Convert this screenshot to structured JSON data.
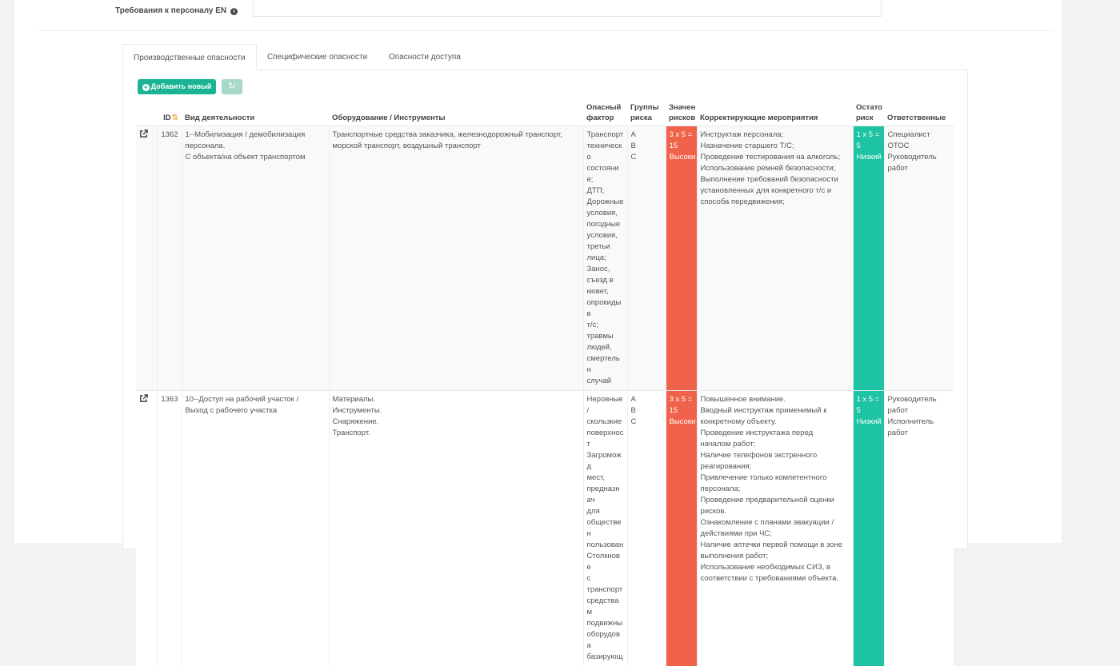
{
  "field": {
    "label": "Требования к персоналу EN",
    "value": ""
  },
  "tabs": [
    {
      "label": "Производственные опасности"
    },
    {
      "label": "Специфические опасности"
    },
    {
      "label": "Опасности доступа"
    }
  ],
  "toolbar": {
    "add_label": "Добавить новый",
    "add_icon": "plus-circle-icon",
    "refresh_icon": "refresh-icon"
  },
  "table": {
    "headers": {
      "id": "ID",
      "activity": "Вид деятельности",
      "equipment": "Оборудование / Инструменты",
      "hazard_line1": "Опасный",
      "hazard_line2": "фактор",
      "groups_line1": "Группы",
      "groups_line2": "риска",
      "value_line1": "Значен",
      "value_line2": "рисков",
      "measures": "Корректирующие мероприятия",
      "residual_line1": "Остато",
      "residual_line2": "риск",
      "responsible": "Ответственные"
    },
    "rows": [
      {
        "id": "1362",
        "activity": [
          "1--Мобилизация / демобилизация",
          "персонала.",
          "С объекта/на объект транспортом"
        ],
        "equipment": [
          "Транспортные средства заказчика, железнодорожный транспорт,",
          "морской транспорт, воздушный транспорт"
        ],
        "hazard": [
          "Транспорт",
          "техническо",
          "состояние;",
          "ДТП;",
          "Дорожные",
          "условия,",
          "погодные",
          "условия,",
          "третьи",
          "лица;",
          "Занос,",
          "съезд в",
          "кювет,",
          "опрокидыв",
          "т/с;",
          "травмы",
          "людей,",
          "смертельн",
          "случай"
        ],
        "groups": [
          "A",
          "B",
          "C"
        ],
        "risk": [
          "3 x 5 =",
          "15",
          "Высоки"
        ],
        "measures": [
          "Инструктаж персонала;",
          "Назначение старшего Т/С;",
          "Проведение тестирования на алкоголь;",
          "Использование ремней безопасности;",
          "Выполнение требований безопасности",
          "установленных для конкретного т/с и",
          "способа передвижения;"
        ],
        "residual": [
          "1 x 5 =",
          "5",
          "Низкий"
        ],
        "responsible": [
          "Специалист",
          "ОТОС",
          "Руководитель",
          "работ"
        ]
      },
      {
        "id": "1363",
        "activity": [
          "10--Доступ на рабочий участок /",
          "Выход с рабочего участка"
        ],
        "equipment": [
          "Материалы.",
          "Инструменты.",
          "Снаряжение.",
          "Транспорт."
        ],
        "hazard": [
          "Неровные",
          "/",
          "скользкие",
          "поверхност",
          "Загроможд",
          "мест,",
          "предназнач",
          "для",
          "обществен",
          "пользован",
          "Столкнове",
          "с",
          "транспорт",
          "средствам",
          "подвижны",
          "оборудова",
          "базирующ"
        ],
        "groups": [
          "A",
          "B",
          "C"
        ],
        "risk": [
          "3 x 5 =",
          "15",
          "Высоки"
        ],
        "measures": [
          "Повышенное внимание.",
          "Вводный инструктаж применимый к",
          "конкретному объекту.",
          "Проведение инструктажа перед",
          "началом работ;",
          "Наличие телефонов экстренного",
          "реагирования;",
          "Привлечение только компетентного",
          "персонала;",
          "Проведение предварительной оценки",
          "рисков.",
          "Ознакомление с планами эвакуации /",
          "действиями при ЧС;",
          "Наличие аптечки первой помощи в зоне",
          "выполнения работ;",
          "Использование необходимых СИЗ, в",
          "соответствии с требованиями объекта."
        ],
        "residual": [
          "1 x 5 =",
          "5",
          "Низкий"
        ],
        "responsible": [
          "Руководитель",
          "работ",
          "Исполнитель",
          "работ"
        ]
      }
    ]
  },
  "colors": {
    "accent": "#1ab394",
    "risk_high": "#f0624a",
    "risk_low": "#1dc3a2"
  }
}
